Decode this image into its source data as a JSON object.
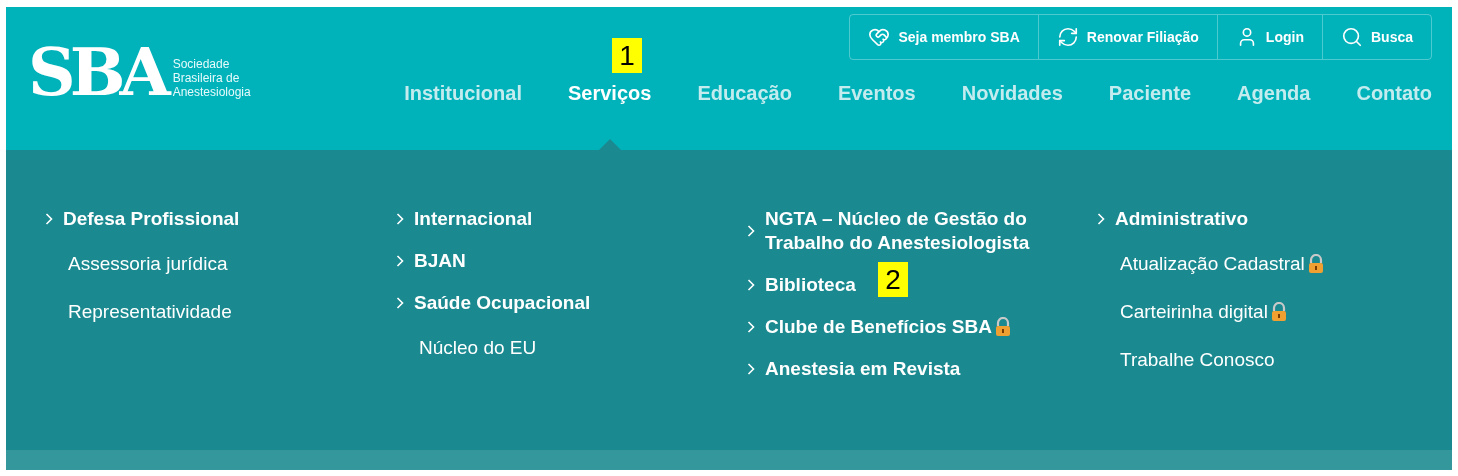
{
  "logo": {
    "mark": "SBA",
    "tagline": [
      "Sociedade",
      "Brasileira de",
      "Anestesiologia"
    ]
  },
  "utility_bar": [
    {
      "kind": "member",
      "label": "Seja membro SBA"
    },
    {
      "kind": "renew",
      "label": "Renovar Filiação"
    },
    {
      "kind": "login",
      "label": "Login"
    },
    {
      "kind": "search",
      "label": "Busca"
    }
  ],
  "nav": [
    {
      "label": "Institucional",
      "selected": false
    },
    {
      "label": "Serviços",
      "selected": true
    },
    {
      "label": "Educação",
      "selected": false
    },
    {
      "label": "Eventos",
      "selected": false
    },
    {
      "label": "Novidades",
      "selected": false
    },
    {
      "label": "Paciente",
      "selected": false
    },
    {
      "label": "Agenda",
      "selected": false
    },
    {
      "label": "Contato",
      "selected": false
    }
  ],
  "mega_menu": [
    {
      "items": [
        {
          "kind": "heading",
          "label": "Defesa Profissional",
          "locked": false
        },
        {
          "kind": "link",
          "label": "Assessoria jurídica",
          "locked": false
        },
        {
          "kind": "link",
          "label": "Representatividade",
          "locked": false
        }
      ]
    },
    {
      "items": [
        {
          "kind": "heading",
          "label": "Internacional",
          "locked": false
        },
        {
          "kind": "heading",
          "label": "BJAN",
          "locked": false
        },
        {
          "kind": "heading",
          "label": "Saúde Ocupacional",
          "locked": false
        },
        {
          "kind": "link",
          "label": "Núcleo do EU",
          "locked": false
        }
      ]
    },
    {
      "items": [
        {
          "kind": "heading",
          "label": "NGTA – Núcleo de Gestão do Trabalho do Anestesiologista",
          "locked": false
        },
        {
          "kind": "heading",
          "label": "Biblioteca",
          "locked": false
        },
        {
          "kind": "heading",
          "label": "Clube de Benefícios SBA",
          "locked": true
        },
        {
          "kind": "heading",
          "label": "Anestesia em Revista",
          "locked": false
        }
      ]
    },
    {
      "items": [
        {
          "kind": "heading",
          "label": "Administrativo",
          "locked": false
        },
        {
          "kind": "link",
          "label": "Atualização Cadastral",
          "locked": true
        },
        {
          "kind": "link",
          "label": "Carteirinha digital",
          "locked": true
        },
        {
          "kind": "link",
          "label": "Trabalhe Conosco",
          "locked": false
        }
      ]
    }
  ],
  "annotations": [
    {
      "label": "1"
    },
    {
      "label": "2"
    }
  ]
}
